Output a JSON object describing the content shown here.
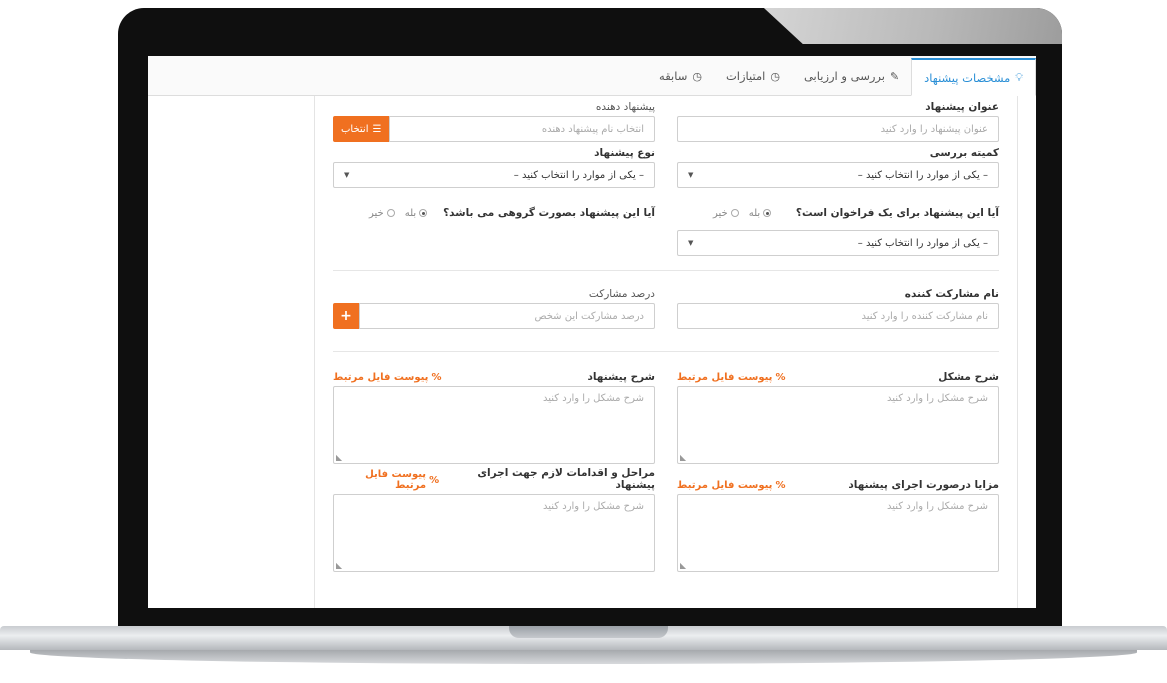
{
  "tabs": [
    {
      "label": "مشخصات پیشنهاد",
      "icon": "lightbulb-icon",
      "active": true
    },
    {
      "label": "بررسی و ارزیابی",
      "icon": "edit-icon",
      "active": false
    },
    {
      "label": "امتیازات",
      "icon": "clock-icon",
      "active": false
    },
    {
      "label": "سابقه",
      "icon": "clock-icon",
      "active": false
    }
  ],
  "form": {
    "title_label": "عنوان پیشنهاد",
    "title_placeholder": "عنوان پیشنهاد را وارد کنید",
    "proposer_label": "پیشنهاد دهنده",
    "proposer_placeholder": "انتخاب نام پیشنهاد دهنده",
    "select_button": "انتخاب",
    "committee_label": "کمیته بررسی",
    "committee_value": "– یکی از موارد را انتخاب کنید –",
    "type_label": "نوع پیشنهاد",
    "type_value": "– یکی از موارد را انتخاب کنید –",
    "callout_question": "آیا این پیشنهاد برای یک فراخوان است؟",
    "group_question": "آیا این پیشنهاد بصورت گروهی می باشد؟",
    "yes": "بله",
    "no": "خیر",
    "callout_select_value": "– یکی از موارد را انتخاب کنید –",
    "participant_label": "نام مشارکت کننده",
    "participant_placeholder": "نام مشارکت کننده را وارد کنید",
    "percent_label": "درصد مشارکت",
    "percent_placeholder": "درصد مشارکت این شخص",
    "add_button": "+",
    "problem_label": "شرح مشکل",
    "proposal_desc_label": "شرح پیشنهاد",
    "benefits_label": "مزایا درصورت اجرای پیشنهاد",
    "steps_label": "مراحل و اقدامات لازم جهت اجرای پیشنهاد",
    "attach_label": "پیوست فایل مرتبط",
    "textarea_placeholder": "شرح مشکل را وارد کنید"
  }
}
